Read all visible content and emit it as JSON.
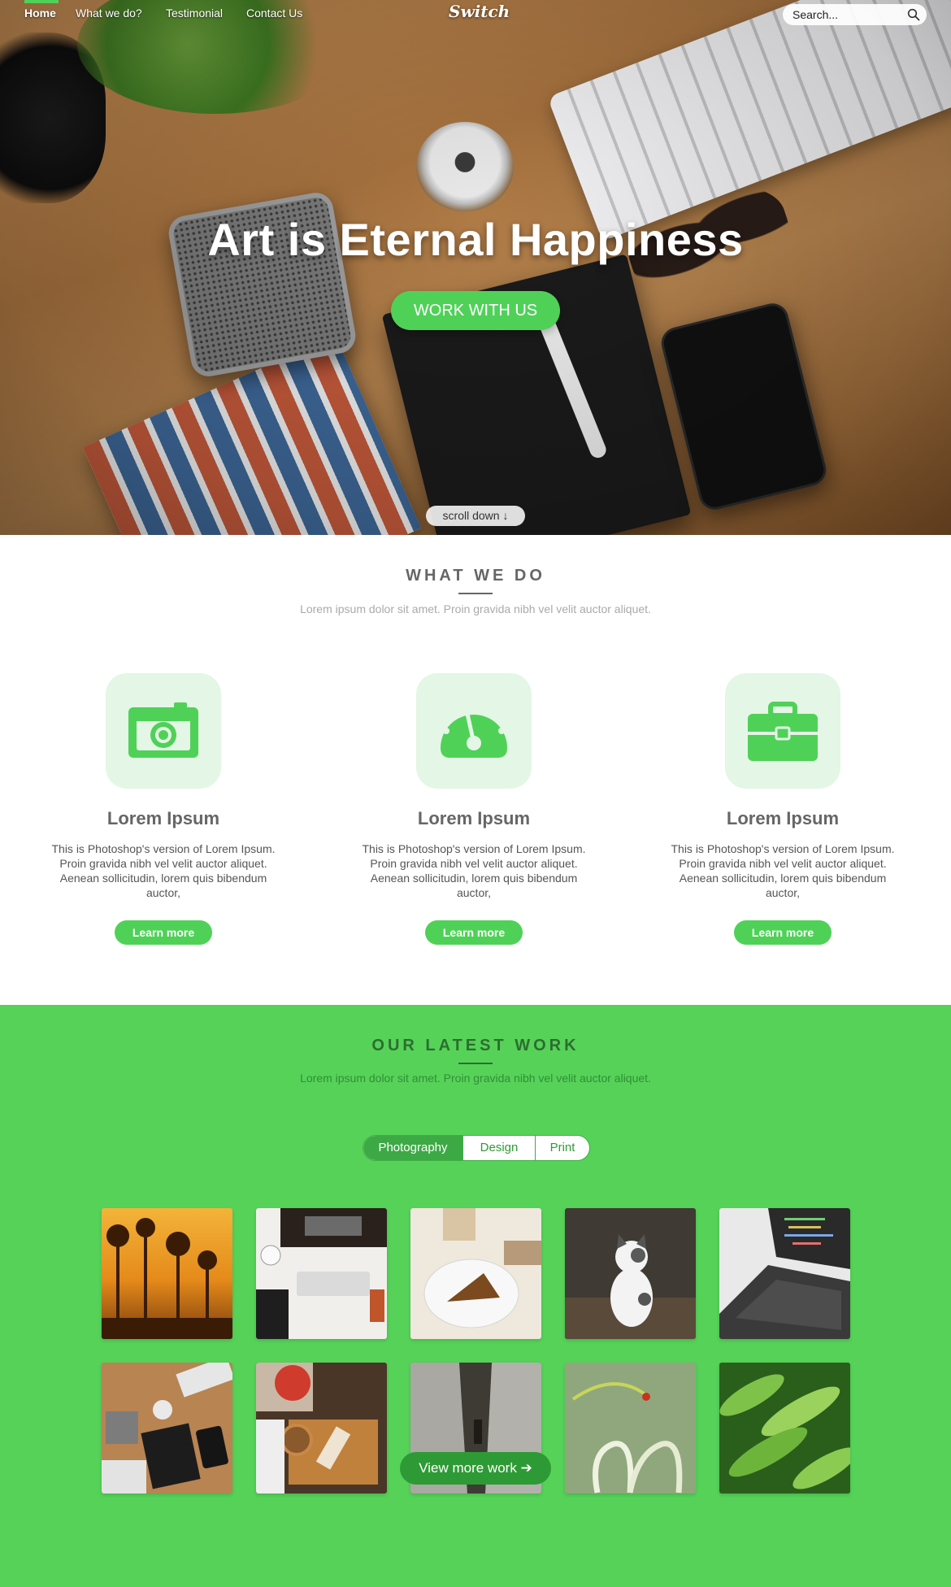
{
  "colors": {
    "accent": "#4fd158",
    "work_bg": "#56d259",
    "icon_bg": "#e4f6e5",
    "dark_green": "#2e9a35"
  },
  "nav": {
    "items": [
      {
        "label": "Home",
        "active": true
      },
      {
        "label": "What we do?"
      },
      {
        "label": "Testimonial"
      },
      {
        "label": "Contact Us"
      }
    ],
    "logo": "Switch",
    "search": {
      "placeholder": "Search...",
      "icon": "search-icon"
    }
  },
  "hero": {
    "title": "Art is Eternal Happiness",
    "cta_label": "WORK WITH US",
    "scroll_label": "scroll down ↓"
  },
  "what_we_do": {
    "title": "WHAT WE DO",
    "subtitle": "Lorem ipsum dolor sit amet. Proin gravida nibh vel velit auctor aliquet.",
    "features": [
      {
        "icon": "camera-icon",
        "title": "Lorem Ipsum",
        "text": "This is Photoshop's version  of Lorem Ipsum. Proin gravida nibh vel velit auctor aliquet. Aenean sollicitudin, lorem quis bibendum auctor,",
        "button": "Learn more"
      },
      {
        "icon": "speedometer-icon",
        "title": "Lorem Ipsum",
        "text": "This is Photoshop's version  of Lorem Ipsum. Proin gravida nibh vel velit auctor aliquet. Aenean sollicitudin, lorem quis bibendum auctor,",
        "button": "Learn more"
      },
      {
        "icon": "briefcase-icon",
        "title": "Lorem Ipsum",
        "text": "This is Photoshop's version  of Lorem Ipsum. Proin gravida nibh vel velit auctor aliquet. Aenean sollicitudin, lorem quis bibendum auctor,",
        "button": "Learn more"
      }
    ]
  },
  "latest_work": {
    "title": "OUR LATEST WORK",
    "subtitle": "Lorem ipsum dolor sit amet. Proin gravida nibh vel velit auctor aliquet.",
    "filters": [
      {
        "label": "Photography",
        "active": true
      },
      {
        "label": "Design"
      },
      {
        "label": "Print"
      }
    ],
    "thumbnails": [
      "sunset-trees",
      "desk-workspace",
      "cake-coffee",
      "kitten",
      "laptop-code",
      "desk-overhead",
      "cooking-table",
      "wooden-boards",
      "ladybug-plant",
      "green-pods"
    ],
    "view_more": "View more work ➔"
  }
}
